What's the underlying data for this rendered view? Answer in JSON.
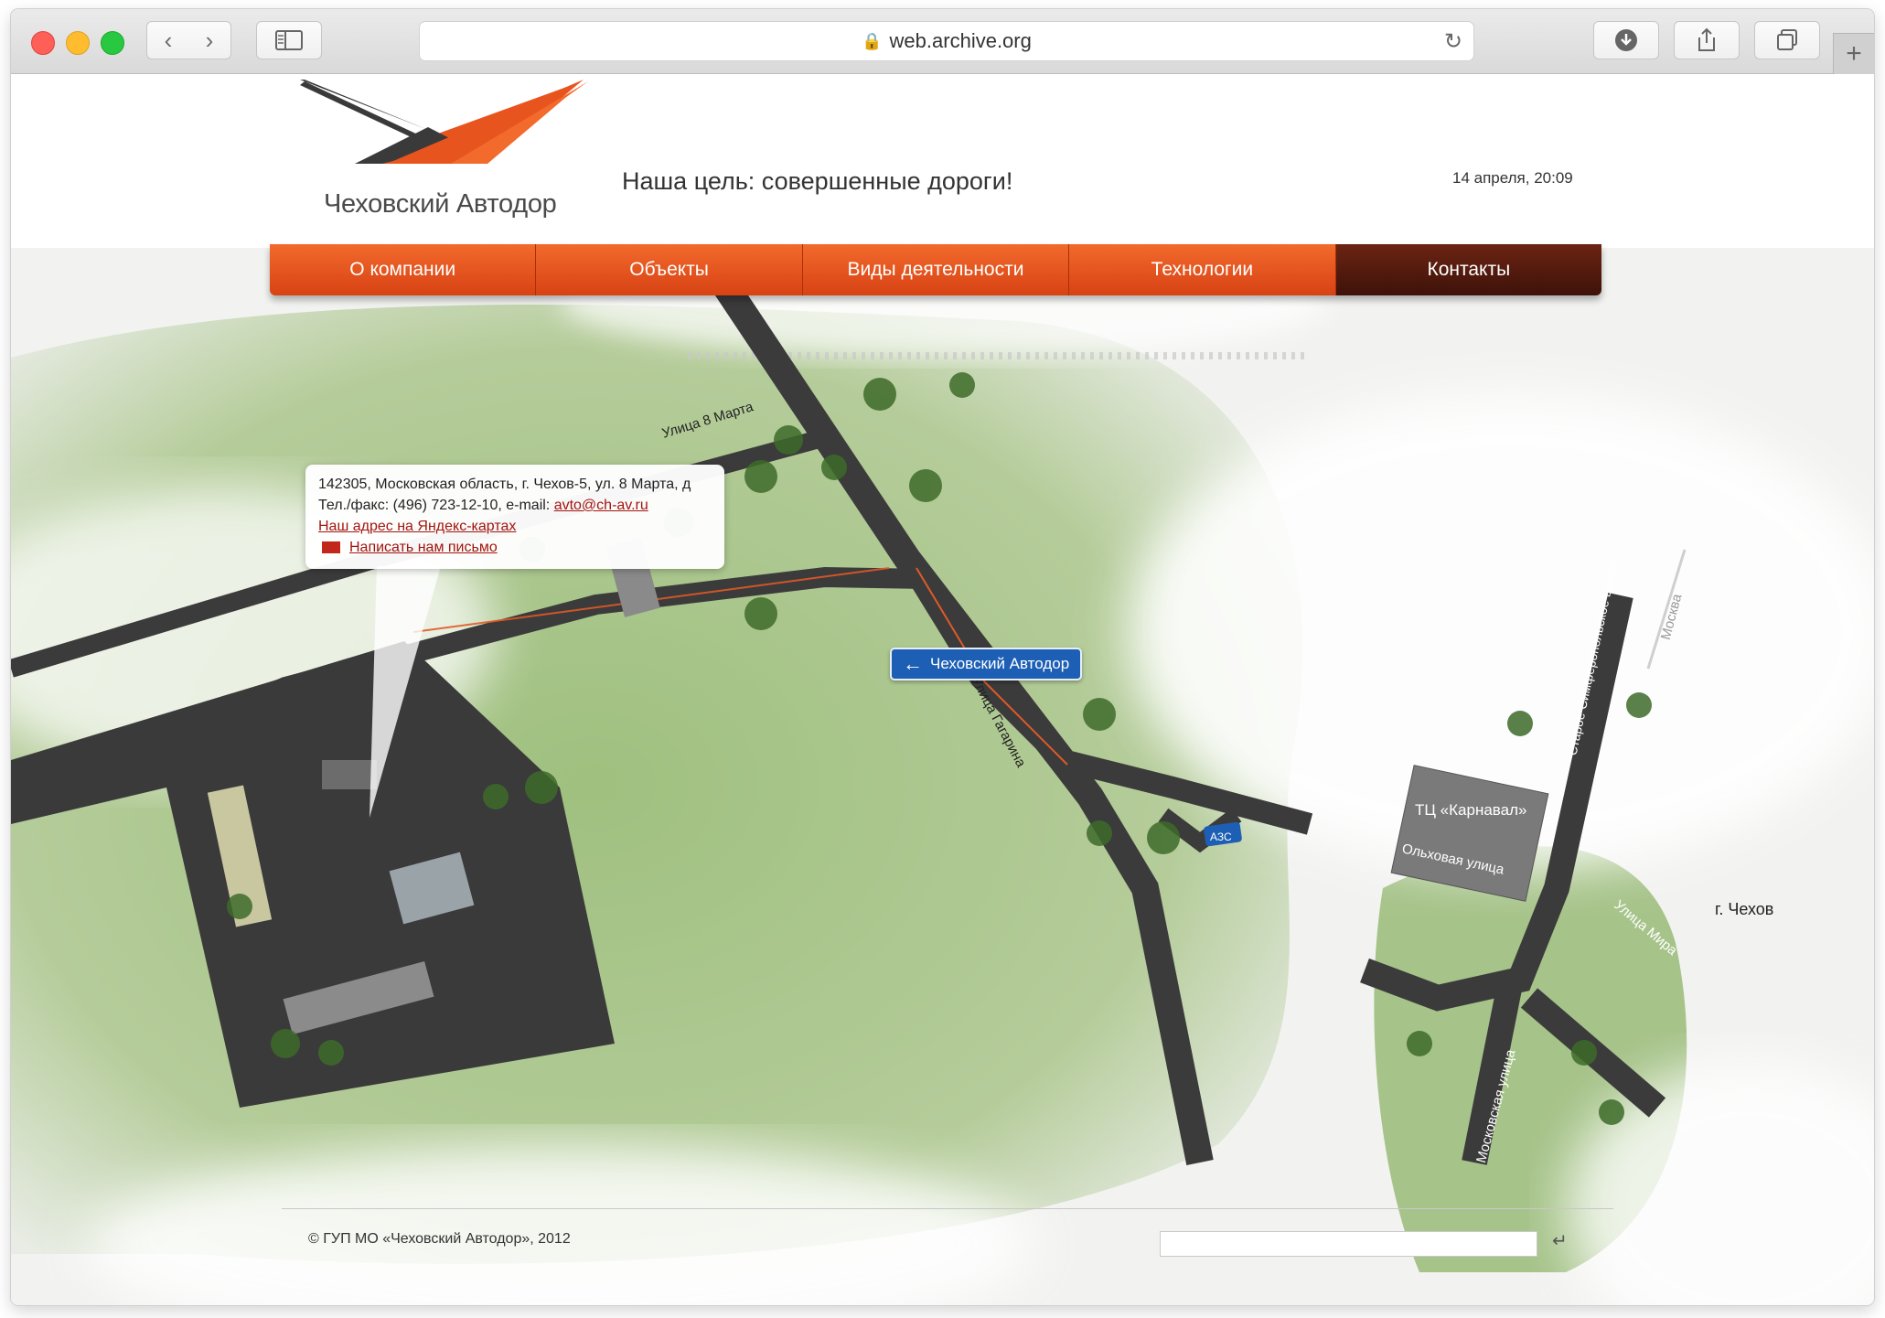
{
  "browser": {
    "url": "web.archive.org",
    "back_icon": "chevron-left-icon",
    "forward_icon": "chevron-right-icon",
    "new_tab_label": "+"
  },
  "header": {
    "logo_text": "Чеховский Автодор",
    "slogan": "Наша цель: совершенные дороги!",
    "datetime": "14 апреля, 20:09"
  },
  "nav": {
    "items": [
      {
        "label": "О компании"
      },
      {
        "label": "Объекты"
      },
      {
        "label": "Виды деятельности"
      },
      {
        "label": "Технологии"
      },
      {
        "label": "Контакты"
      }
    ],
    "active_index": 4
  },
  "contact": {
    "address": "142305, Московская область, г. Чехов-5, ул. 8 Марта, д",
    "phone_prefix": "Тел./факс: (496) 723-12-10, e-mail: ",
    "email": "avto@ch-av.ru",
    "map_link": "Наш адрес на Яндекс-картах",
    "write_link": "Написать нам письмо"
  },
  "map": {
    "sign_label": "Чеховский Автодор",
    "street_8marta": "Улица 8 Марта",
    "street_gagarina": "Улица Гагарина",
    "azs": "АЗС",
    "mall": "ТЦ «Карнавал»",
    "street_olkhovaya": "Ольховая улица",
    "street_moskovskaya": "Московская улица",
    "street_mira": "Улица Мира",
    "highway": "Старое Симферопольское шоссе",
    "direction_moscow": "Москва",
    "city_chekhov": "г. Чехов"
  },
  "footer": {
    "copyright": "© ГУП МО «Чеховский Автодор», 2012",
    "enter_symbol": "↵"
  },
  "colors": {
    "accent": "#e8541e",
    "nav_active": "#5a1e10",
    "link": "#a3150e",
    "sign": "#1d5fb4",
    "grass": "#a8c48a"
  }
}
